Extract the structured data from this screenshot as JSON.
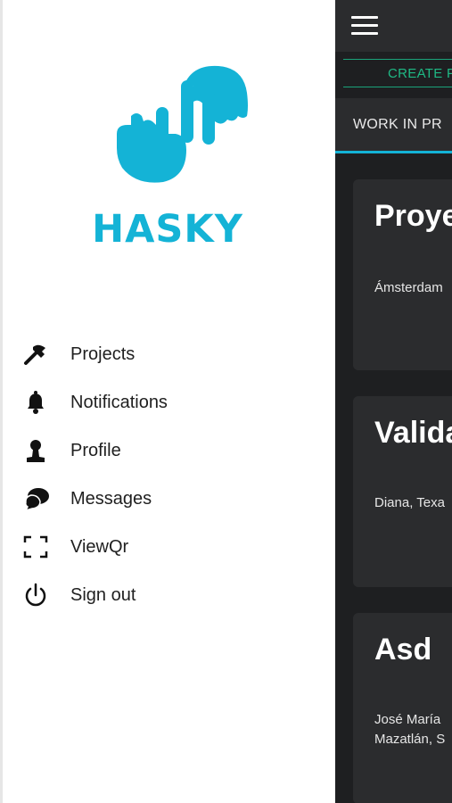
{
  "drawer": {
    "brand": "HASKY",
    "items": [
      {
        "label": "Projects",
        "icon": "hammer-icon"
      },
      {
        "label": "Notifications",
        "icon": "bell-icon"
      },
      {
        "label": "Profile",
        "icon": "person-icon"
      },
      {
        "label": "Messages",
        "icon": "chat-bubbles-icon"
      },
      {
        "label": "ViewQr",
        "icon": "qr-scan-icon"
      },
      {
        "label": "Sign out",
        "icon": "power-icon"
      }
    ]
  },
  "app": {
    "create_button": "CREATE P",
    "tab_label": "WORK IN PR",
    "cards": [
      {
        "title": "Proye",
        "location": "Ámsterdam"
      },
      {
        "title": "Valida",
        "location": "Diana, Texa"
      },
      {
        "title": "Asd",
        "location": "José María\nMazatlán, S"
      }
    ]
  },
  "colors": {
    "brand": "#14b3d6",
    "accent_green": "#1fb884",
    "dark_bg": "#1e1f21",
    "card_bg": "#2b2c2e"
  }
}
